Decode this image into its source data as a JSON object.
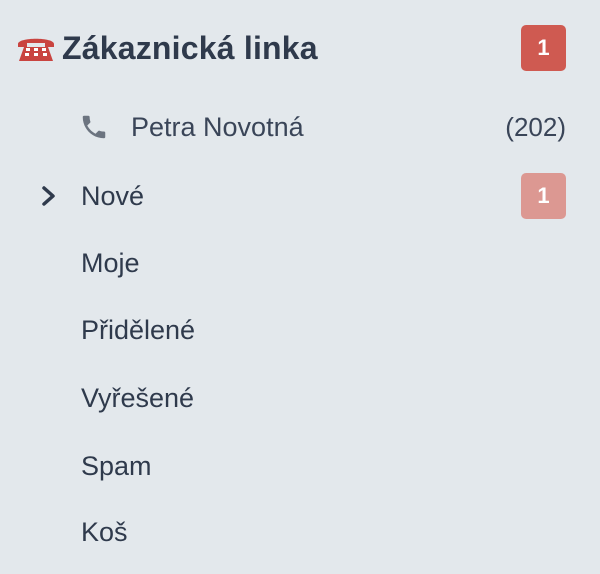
{
  "queue": {
    "title": "Zákaznická linka",
    "icon": "telephone-icon",
    "unread_count": "1",
    "badge_color": "#cf5a51"
  },
  "agent": {
    "icon": "phone-handset-icon",
    "name": "Petra Novotná",
    "extension": "(202)"
  },
  "folders": [
    {
      "label": "Nové",
      "badge": "1",
      "expanded_icon": "chevron-right-icon",
      "badge_color": "#dc9892"
    },
    {
      "label": "Moje"
    },
    {
      "label": "Přidělené"
    },
    {
      "label": "Vyřešené"
    },
    {
      "label": "Spam"
    },
    {
      "label": "Koš"
    }
  ],
  "colors": {
    "background": "#e3e8ec",
    "text": "#2f3a4c",
    "icon_gray": "#6c7480",
    "phone_red": "#c94440"
  }
}
